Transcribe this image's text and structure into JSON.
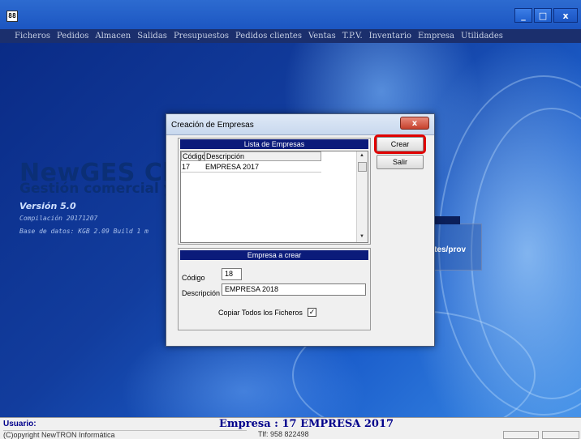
{
  "app": {
    "icon": "app-icon",
    "window_buttons": [
      "_",
      "□",
      "x"
    ]
  },
  "menu": [
    "Ficheros",
    "Pedidos",
    "Almacen",
    "Salidas",
    "Presupuestos",
    "Pedidos clientes",
    "Ventas",
    "T.P.V.",
    "Inventario",
    "Empresa",
    "Utilidades"
  ],
  "splash": {
    "brand": "NewGES Cl",
    "subtitle": "Gestión comercial y",
    "version": "Versión 5.0",
    "compilation": "Compilación 20171207",
    "database": "Base de datos: KGB 2.09 Build 1 m",
    "panel_header": "a",
    "panel_text": "ntes/prov"
  },
  "dialog": {
    "title": "Creación de Empresas",
    "close_label": "x",
    "list_header": "Lista de Empresas",
    "columns": [
      "Código",
      "Descripción"
    ],
    "rows": [
      {
        "codigo": "17",
        "descripcion": "EMPRESA 2017"
      }
    ],
    "buttons": {
      "crear": "Crear",
      "salir": "Salir"
    },
    "new_header": "Empresa a crear",
    "codigo_label": "Código",
    "codigo_value": "18",
    "descripcion_label": "Descripción",
    "descripcion_value": "EMPRESA 2018",
    "copy_label": "Copiar Todos los Ficheros",
    "copy_checked": true
  },
  "status": {
    "usuario_label": "Usuario:",
    "empresa": "Empresa : 17 EMPRESA 2017",
    "copyright": "(C)opyright NewTRON Informática",
    "phone": "Tlf: 958 822498"
  }
}
